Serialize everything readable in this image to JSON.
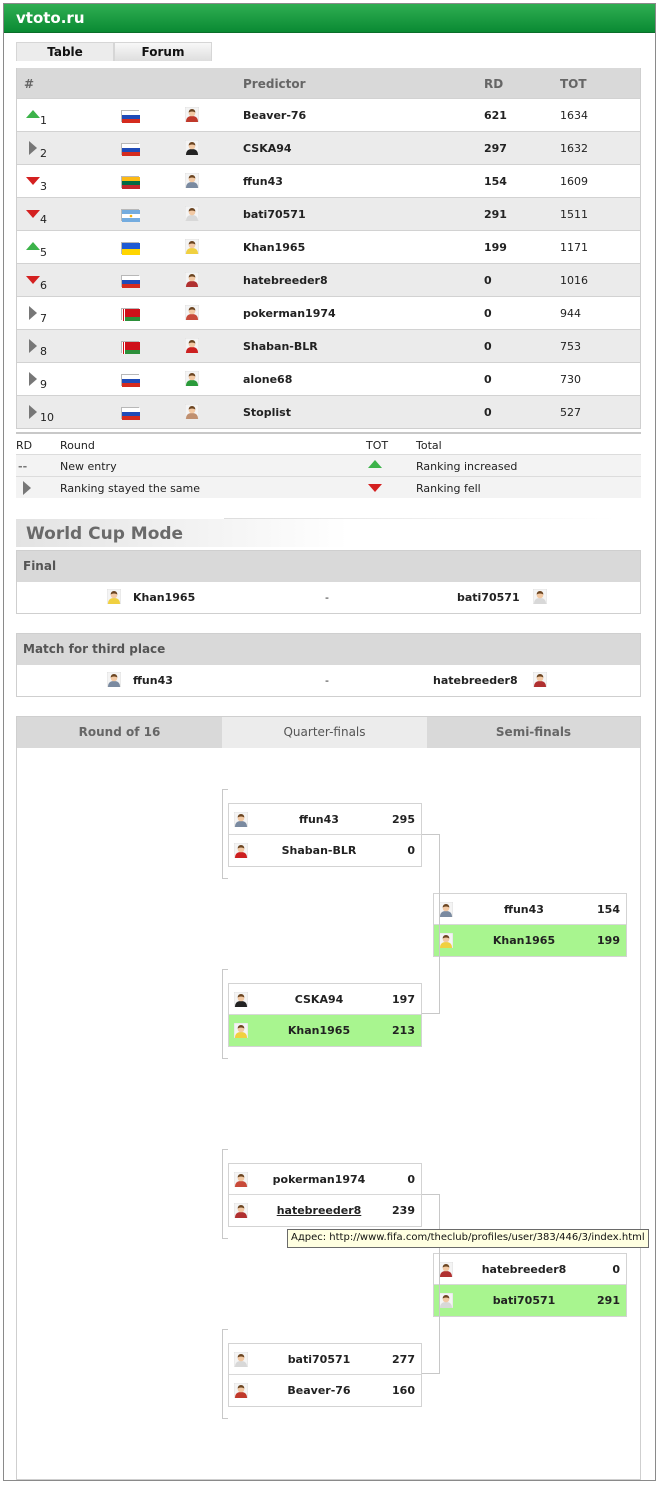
{
  "site": {
    "title": "vtoto.ru"
  },
  "tabs": [
    {
      "label": "Table"
    },
    {
      "label": "Forum"
    }
  ],
  "table": {
    "headers": {
      "rank": "#",
      "predictor": "Predictor",
      "rd": "RD",
      "tot": "TOT"
    },
    "rows": [
      {
        "rank": "1",
        "trend": "up",
        "flag": "russia",
        "name": "Beaver-76",
        "rd": "621",
        "tot": "1634",
        "shirt": "#c0392b"
      },
      {
        "rank": "2",
        "trend": "same",
        "flag": "russia",
        "name": "CSKA94",
        "rd": "297",
        "tot": "1632",
        "shirt": "#222222"
      },
      {
        "rank": "3",
        "trend": "down",
        "flag": "lithuania",
        "name": "ffun43",
        "rd": "154",
        "tot": "1609",
        "shirt": "#7a8aa0"
      },
      {
        "rank": "4",
        "trend": "down",
        "flag": "argentina",
        "name": "bati70571",
        "rd": "291",
        "tot": "1511",
        "shirt": "#d8d8d8"
      },
      {
        "rank": "5",
        "trend": "up",
        "flag": "ukraine",
        "name": "Khan1965",
        "rd": "199",
        "tot": "1171",
        "shirt": "#f0d040"
      },
      {
        "rank": "6",
        "trend": "down",
        "flag": "russia",
        "name": "hatebreeder8",
        "rd": "0",
        "tot": "1016",
        "shirt": "#b03030"
      },
      {
        "rank": "7",
        "trend": "same",
        "flag": "belarus",
        "name": "pokerman1974",
        "rd": "0",
        "tot": "944",
        "shirt": "#c84a3a"
      },
      {
        "rank": "8",
        "trend": "same",
        "flag": "belarus",
        "name": "Shaban-BLR",
        "rd": "0",
        "tot": "753",
        "shirt": "#cc2020"
      },
      {
        "rank": "9",
        "trend": "same",
        "flag": "russia",
        "name": "alone68",
        "rd": "0",
        "tot": "730",
        "shirt": "#2a9a3a"
      },
      {
        "rank": "10",
        "trend": "same",
        "flag": "russia",
        "name": "Stoplist",
        "rd": "0",
        "tot": "527",
        "shirt": "#c09070"
      }
    ]
  },
  "legend": {
    "rd_abbr": "RD",
    "rd_text": "Round",
    "tot_abbr": "TOT",
    "tot_text": "Total",
    "new_entry_symbol": "--",
    "new_entry": "New entry",
    "increased": "Ranking increased",
    "same": "Ranking stayed the same",
    "fell": "Ranking fell"
  },
  "worldcup": {
    "title": "World Cup Mode",
    "final": {
      "label": "Final",
      "home": "Khan1965",
      "sep": "-",
      "away": "bati70571"
    },
    "third": {
      "label": "Match for third place",
      "home": "ffun43",
      "sep": "-",
      "away": "hatebreeder8"
    },
    "bracket_tabs": [
      {
        "label": "Round of 16"
      },
      {
        "label": "Quarter-finals"
      },
      {
        "label": "Semi-finals"
      }
    ],
    "quarterfinals": [
      {
        "p1": "ffun43",
        "s1": "295",
        "p2": "Shaban-BLR",
        "s2": "0"
      },
      {
        "p1": "CSKA94",
        "s1": "197",
        "p2": "Khan1965",
        "s2": "213"
      },
      {
        "p1": "pokerman1974",
        "s1": "0",
        "p2": "hatebreeder8",
        "s2": "239"
      },
      {
        "p1": "bati70571",
        "s1": "277",
        "p2": "Beaver-76",
        "s2": "160"
      }
    ],
    "semifinals": [
      {
        "p1": "ffun43",
        "s1": "154",
        "p2": "Khan1965",
        "s2": "199"
      },
      {
        "p1": "hatebreeder8",
        "s1": "0",
        "p2": "bati70571",
        "s2": "291"
      }
    ]
  },
  "tooltip": {
    "text": "Адрес: http://www.fifa.com/theclub/profiles/user/383/446/3/index.html"
  },
  "colors": {
    "accent": "#0a8a33",
    "winner": "#a8f58f",
    "up": "#3cb34a",
    "down": "#d42020"
  }
}
